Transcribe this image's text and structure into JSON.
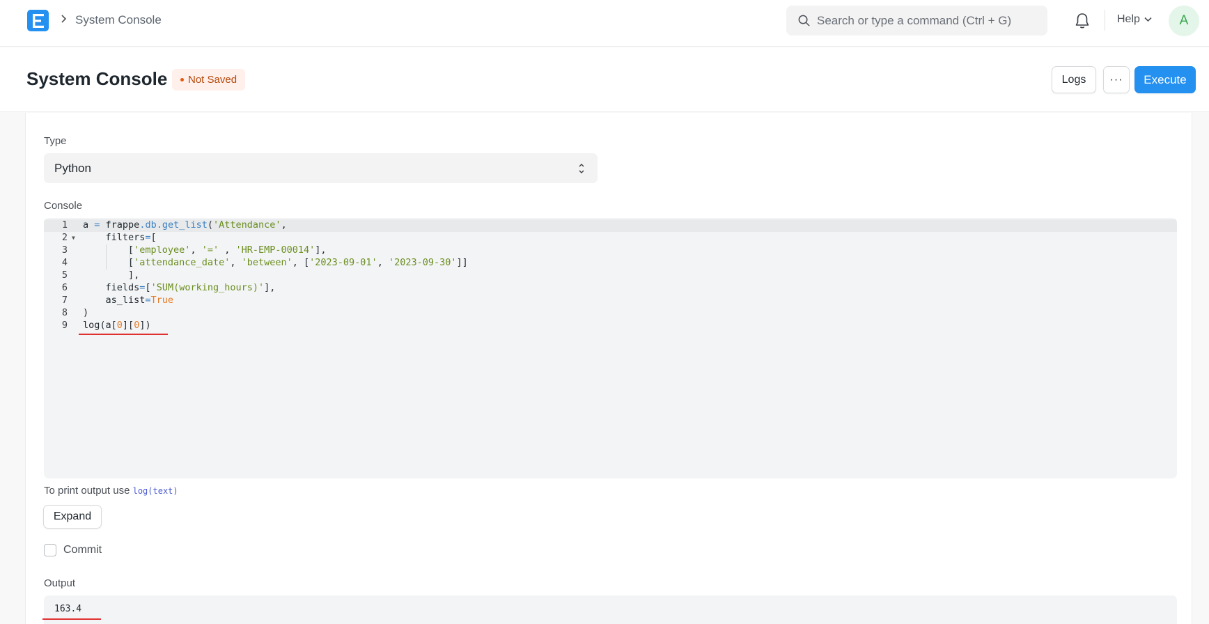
{
  "navbar": {
    "logo_letter": "E",
    "breadcrumb": "System Console",
    "search_placeholder": "Search or type a command (Ctrl + G)",
    "help_label": "Help",
    "avatar_letter": "A"
  },
  "page": {
    "title": "System Console",
    "status": "Not Saved",
    "logs_label": "Logs",
    "more_label": "···",
    "execute_label": "Execute"
  },
  "form": {
    "type_label": "Type",
    "type_value": "Python",
    "console_label": "Console",
    "hint_text": "To print output use",
    "hint_code": "log(text)",
    "expand_label": "Expand",
    "commit_label": "Commit",
    "output_label": "Output",
    "output_value": "163.4"
  },
  "code": {
    "line_numbers": [
      "1",
      "2",
      "3",
      "4",
      "5",
      "6",
      "7",
      "8",
      "9"
    ],
    "lines": [
      "a = frappe.db.get_list('Attendance',",
      "    filters=[",
      "        ['employee', '=' , 'HR-EMP-00014'],",
      "        ['attendance_date', 'between', ['2023-09-01', '2023-09-30']]",
      "        ],",
      "    fields=['SUM(working_hours)'],",
      "    as_list=True",
      ")",
      "log(a[0][0])"
    ]
  },
  "colors": {
    "primary": "#2490ef",
    "status_text": "#b54708",
    "status_bg": "#fff0ec",
    "annotation_red": "#e03131"
  }
}
